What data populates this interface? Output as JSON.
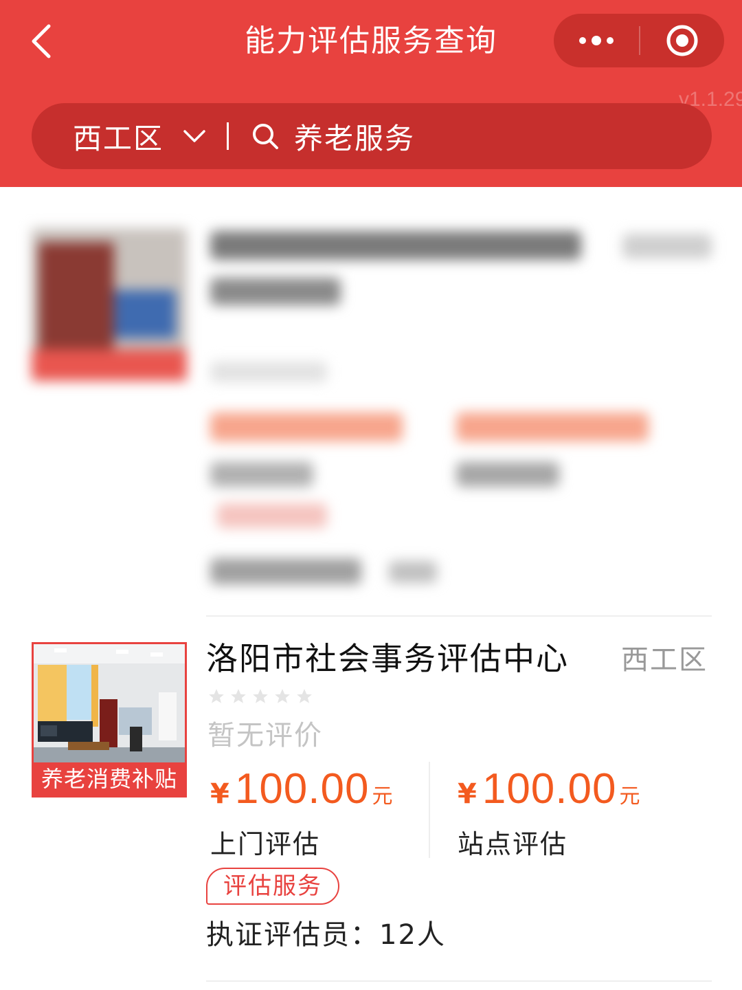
{
  "header": {
    "title": "能力评估服务查询",
    "version": "v1.1.29",
    "bg_color": "#e8423f",
    "back_icon": "chevron-left-icon",
    "more_icon": "more-dots-icon",
    "close_icon": "target-circle-icon"
  },
  "search": {
    "district": "西工区",
    "query": "养老服务",
    "search_icon": "search-icon",
    "dropdown_icon": "chevron-down-icon"
  },
  "listings": [
    {
      "blurred": true
    },
    {
      "name": "洛阳市社会事务评估中心",
      "district": "西工区",
      "image_tag": "养老消费补贴",
      "rating_stars": 0,
      "rating_text": "暂无评价",
      "prices": [
        {
          "currency": "¥",
          "amount": "100.00",
          "unit": "元",
          "label": "上门评估"
        },
        {
          "currency": "¥",
          "amount": "100.00",
          "unit": "元",
          "label": "站点评估"
        }
      ],
      "service_tag": "评估服务",
      "assessors": "执证评估员：12人"
    }
  ],
  "colors": {
    "accent": "#e8423f",
    "price": "#f35a1f",
    "muted": "#999999"
  }
}
